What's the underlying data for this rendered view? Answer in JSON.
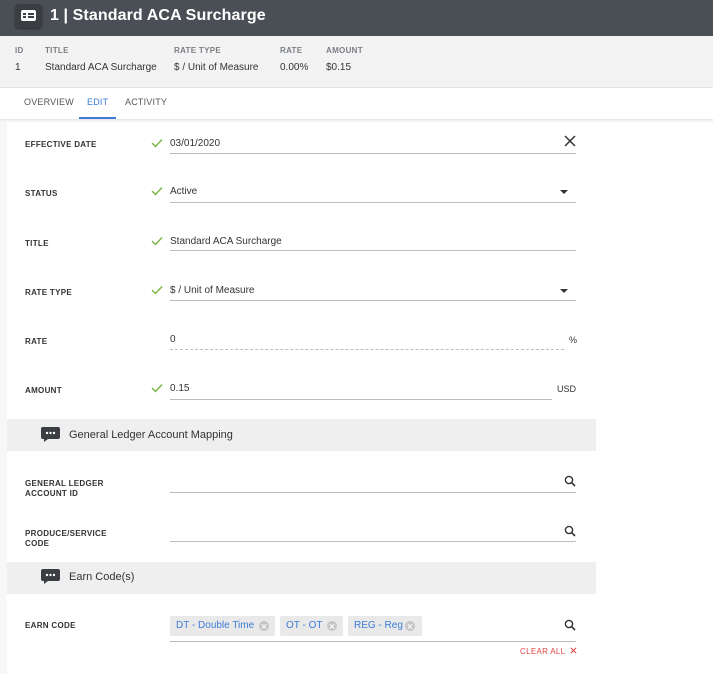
{
  "header": {
    "title": "1 | Standard ACA Surcharge",
    "icon": "id-card-icon"
  },
  "summary": {
    "columns": [
      {
        "head": "ID",
        "value": "1"
      },
      {
        "head": "TITLE",
        "value": "Standard ACA Surcharge"
      },
      {
        "head": "RATE TYPE",
        "value": "$ / Unit of Measure"
      },
      {
        "head": "RATE",
        "value": "0.00%"
      },
      {
        "head": "AMOUNT",
        "value": "$0.15"
      }
    ]
  },
  "tabs": [
    {
      "label": "OVERVIEW",
      "active": false
    },
    {
      "label": "EDIT",
      "active": true
    },
    {
      "label": "ACTIVITY",
      "active": false
    }
  ],
  "form": {
    "effective_date": {
      "label": "EFFECTIVE DATE",
      "value": "03/01/2020"
    },
    "status": {
      "label": "STATUS",
      "value": "Active"
    },
    "title": {
      "label": "TITLE",
      "value": "Standard ACA Surcharge"
    },
    "rate_type": {
      "label": "RATE TYPE",
      "value": "$ / Unit of Measure"
    },
    "rate": {
      "label": "RATE",
      "value": "0",
      "unit": "%"
    },
    "amount": {
      "label": "AMOUNT",
      "value": "0.15",
      "unit": "USD"
    }
  },
  "sections": {
    "gl": {
      "title": "General Ledger Account Mapping"
    },
    "earn": {
      "title": "Earn Code(s)"
    }
  },
  "gl_fields": {
    "account_id": {
      "label_line1": "GENERAL LEDGER",
      "label_line2": "ACCOUNT ID",
      "value": ""
    },
    "product_service": {
      "label_line1": "PRODUCE/SERVICE",
      "label_line2": "CODE",
      "value": ""
    }
  },
  "earn_code": {
    "label": "EARN CODE",
    "chips": [
      "DT - Double Time",
      "OT - OT",
      "REG - Reg"
    ],
    "clear_all": "CLEAR ALL"
  },
  "colors": {
    "accent": "#3d7bd6",
    "header_bg": "#4a4f55",
    "check": "#7cb342",
    "clear": "#e04545"
  }
}
